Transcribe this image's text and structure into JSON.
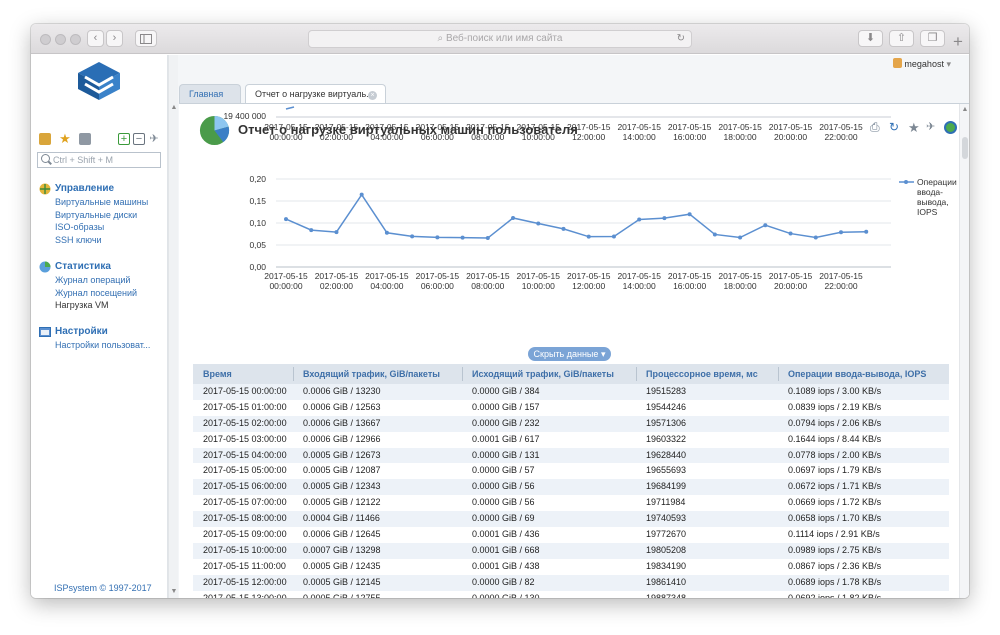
{
  "browser": {
    "url_placeholder": "Веб-поиск или имя сайта",
    "back": "‹",
    "forward": "›",
    "new_tab": "+"
  },
  "user": {
    "name": "megahost"
  },
  "sidebar": {
    "search_placeholder": "Ctrl + Shift + M",
    "groups": [
      {
        "title": "Управление",
        "items": [
          "Виртуальные машины",
          "Виртуальные диски",
          "ISO-образы",
          "SSH ключи"
        ]
      },
      {
        "title": "Статистика",
        "items": [
          "Журнал операций",
          "Журнал посещений",
          "Нагрузка VM"
        ]
      },
      {
        "title": "Настройки",
        "items": [
          "Настройки пользоват..."
        ]
      }
    ],
    "copyright": "ISPsystem © 1997-2017"
  },
  "tabs": [
    {
      "label": "Главная"
    },
    {
      "label": "Отчет о нагрузке виртуаль..."
    }
  ],
  "page": {
    "title": "Отчет о нагрузке виртуальных машин пользователя"
  },
  "hide_button": "Скрыть данные",
  "chart_data": [
    {
      "type": "line",
      "y_tick_visible": "19 400 000",
      "x_ticks": [
        "2017-05-15 00:00:00",
        "2017-05-15 02:00:00",
        "2017-05-15 04:00:00",
        "2017-05-15 06:00:00",
        "2017-05-15 08:00:00",
        "2017-05-15 10:00:00",
        "2017-05-15 12:00:00",
        "2017-05-15 14:00:00",
        "2017-05-15 16:00:00",
        "2017-05-15 18:00:00",
        "2017-05-15 20:00:00",
        "2017-05-15 22:00:00"
      ]
    },
    {
      "type": "line",
      "ylim": [
        0,
        0.2
      ],
      "y_ticks": [
        "0,00",
        "0,05",
        "0,10",
        "0,15",
        "0,20"
      ],
      "x_ticks": [
        "2017-05-15 00:00:00",
        "2017-05-15 02:00:00",
        "2017-05-15 04:00:00",
        "2017-05-15 06:00:00",
        "2017-05-15 08:00:00",
        "2017-05-15 10:00:00",
        "2017-05-15 12:00:00",
        "2017-05-15 14:00:00",
        "2017-05-15 16:00:00",
        "2017-05-15 18:00:00",
        "2017-05-15 20:00:00",
        "2017-05-15 22:00:00"
      ],
      "legend": "top-right",
      "series": [
        {
          "name": "Операции ввода-вывода, IOPS",
          "color": "#5b8fd0",
          "values": [
            0.1089,
            0.0839,
            0.0794,
            0.1644,
            0.0778,
            0.0697,
            0.0672,
            0.0669,
            0.0658,
            0.1114,
            0.0989,
            0.0867,
            0.0689,
            0.0692,
            0.108,
            0.111,
            0.12,
            0.074,
            0.067,
            0.095,
            0.076,
            0.067,
            0.079,
            0.08
          ]
        }
      ]
    }
  ],
  "table": {
    "columns": [
      "Время",
      "Входящий трафик, GiB/пакеты",
      "Исходящий трафик, GiB/пакеты",
      "Процессорное время, мс",
      "Операции ввода-вывода, IOPS"
    ],
    "rows": [
      [
        "2017-05-15 00:00:00",
        "0.0006 GiB / 13230",
        "0.0000 GiB / 384",
        "19515283",
        "0.1089 iops / 3.00 KB/s"
      ],
      [
        "2017-05-15 01:00:00",
        "0.0006 GiB / 12563",
        "0.0000 GiB / 157",
        "19544246",
        "0.0839 iops / 2.19 KB/s"
      ],
      [
        "2017-05-15 02:00:00",
        "0.0006 GiB / 13667",
        "0.0000 GiB / 232",
        "19571306",
        "0.0794 iops / 2.06 KB/s"
      ],
      [
        "2017-05-15 03:00:00",
        "0.0006 GiB / 12966",
        "0.0001 GiB / 617",
        "19603322",
        "0.1644 iops / 8.44 KB/s"
      ],
      [
        "2017-05-15 04:00:00",
        "0.0005 GiB / 12673",
        "0.0000 GiB / 131",
        "19628440",
        "0.0778 iops / 2.00 KB/s"
      ],
      [
        "2017-05-15 05:00:00",
        "0.0005 GiB / 12087",
        "0.0000 GiB / 57",
        "19655693",
        "0.0697 iops / 1.79 KB/s"
      ],
      [
        "2017-05-15 06:00:00",
        "0.0005 GiB / 12343",
        "0.0000 GiB / 56",
        "19684199",
        "0.0672 iops / 1.71 KB/s"
      ],
      [
        "2017-05-15 07:00:00",
        "0.0005 GiB / 12122",
        "0.0000 GiB / 56",
        "19711984",
        "0.0669 iops / 1.72 KB/s"
      ],
      [
        "2017-05-15 08:00:00",
        "0.0004 GiB / 11466",
        "0.0000 GiB / 69",
        "19740593",
        "0.0658 iops / 1.70 KB/s"
      ],
      [
        "2017-05-15 09:00:00",
        "0.0006 GiB / 12645",
        "0.0001 GiB / 436",
        "19772670",
        "0.1114 iops / 2.91 KB/s"
      ],
      [
        "2017-05-15 10:00:00",
        "0.0007 GiB / 13298",
        "0.0001 GiB / 668",
        "19805208",
        "0.0989 iops / 2.75 KB/s"
      ],
      [
        "2017-05-15 11:00:00",
        "0.0005 GiB / 12435",
        "0.0001 GiB / 438",
        "19834190",
        "0.0867 iops / 2.36 KB/s"
      ],
      [
        "2017-05-15 12:00:00",
        "0.0005 GiB / 12145",
        "0.0000 GiB / 82",
        "19861410",
        "0.0689 iops / 1.78 KB/s"
      ],
      [
        "2017-05-15 13:00:00",
        "0.0005 GiB / 12755",
        "0.0000 GiB / 130",
        "19887348",
        "0.0692 iops / 1.82 KB/s"
      ]
    ]
  }
}
